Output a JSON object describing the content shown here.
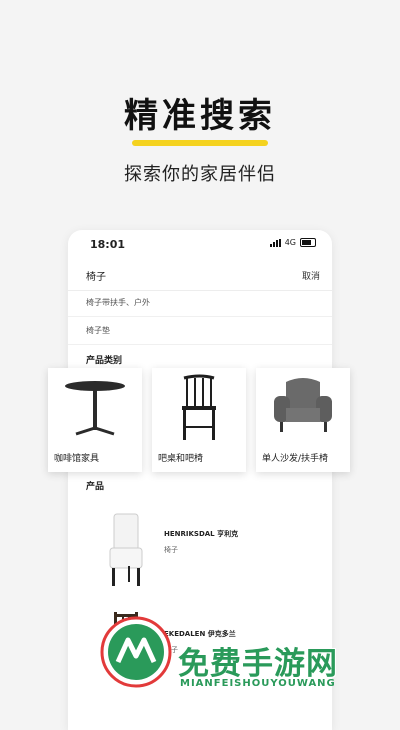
{
  "headline": "精准搜索",
  "subheadline": "探索你的家居伴侣",
  "accent_color": "#f4d21f",
  "phone": {
    "status_time": "18:01",
    "network": "4G",
    "search": {
      "query": "椅子",
      "cancel_label": "取消"
    },
    "suggestions": [
      "椅子带扶手、户外",
      "椅子垫"
    ],
    "category_section_title": "产品类别",
    "categories": [
      {
        "label": "咖啡馆家具",
        "icon": "cafe-table-icon"
      },
      {
        "label": "吧桌和吧椅",
        "icon": "bar-stool-icon"
      },
      {
        "label": "单人沙发/扶手椅",
        "icon": "armchair-icon"
      }
    ],
    "product_section_title": "产品",
    "products": [
      {
        "name": "HENRIKSDAL 亨利克",
        "type": "椅子",
        "icon": "upholstered-chair-icon"
      },
      {
        "name": "EKEDALEN 伊克多兰",
        "type": "椅子",
        "icon": "wooden-chair-icon"
      }
    ]
  },
  "watermark": {
    "title": "免费手游网",
    "subtitle": "MIANFEISHOUYOUWANG",
    "color": "#2a9a5a"
  }
}
